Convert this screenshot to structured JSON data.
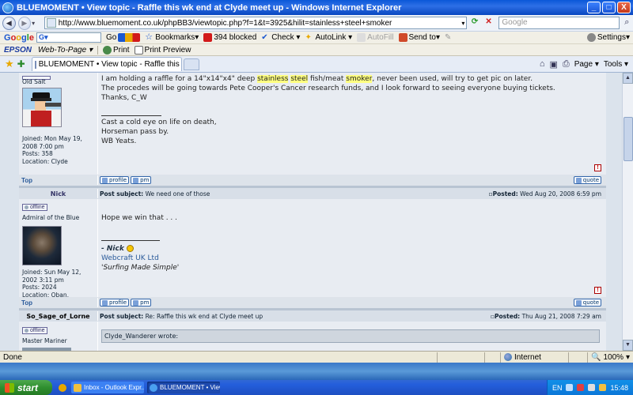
{
  "window": {
    "title": "BLUEMOMENT • View topic - Raffle this wk end at Clyde meet up - Windows Internet Explorer",
    "minimize": "_",
    "maximize": "□",
    "close": "X"
  },
  "address": {
    "url": "http://www.bluemoment.co.uk/phpBB3/viewtopic.php?f=1&t=3925&hilit=stainless+steel+smoker",
    "search_placeholder": "Google"
  },
  "google_toolbar": {
    "logo_parts": [
      "G",
      "o",
      "o",
      "g",
      "l",
      "e"
    ],
    "search_value": "G▾",
    "go": "Go",
    "bookmarks": "Bookmarks▾",
    "blocked": "394 blocked",
    "check": "Check ▾",
    "autolink": "AutoLink ▾",
    "autofill": "AutoFill",
    "send_to": "Send to▾",
    "settings": "Settings▾"
  },
  "epson_toolbar": {
    "logo": "EPSON",
    "web_to_page": "Web-To-Page ▾",
    "print": "Print",
    "print_preview": "Print Preview"
  },
  "tabs": {
    "active_tab": "BLUEMOMENT • View topic - Raffle this wk end at Clyde...",
    "page": "Page ▾",
    "tools": "Tools ▾"
  },
  "posts": [
    {
      "rank": "Old Salt",
      "joined": "Joined: Mon May 19, 2008 7:00 pm",
      "posts": "Posts: 358",
      "location": "Location: Clyde",
      "body_line1_pre": "I am holding a raffle for a 14\"x14\"x4\" deep ",
      "hl1": "stainless",
      "hl2": "steel",
      "mid1": " fish/meat ",
      "hl3": "smoker",
      "body_line1_post": ", never been used, will try to get pic on later.",
      "body_line2": "The procedes will be going towards Pete Cooper's Cancer research funds, and I look forward to seeing everyone buying tickets.",
      "body_line3": "Thanks, C_W",
      "sig_line1": "Cast a cold eye on life on death,",
      "sig_line2": "Horseman pass by.",
      "sig_line3": "WB Yeats."
    },
    {
      "author": "Nick",
      "subject_label": "Post subject:",
      "subject": "We need one of those",
      "posted_label": "Posted:",
      "posted": "Wed Aug 20, 2008 6:59 pm",
      "status": "offline",
      "rank": "Admiral of the Blue",
      "joined": "Joined: Sun May 12, 2002 3:11 pm",
      "posts": "Posts: 2024",
      "location": "Location: Oban, Scotland",
      "body": "Hope we win that . . .",
      "sig_name": "- Nick",
      "sig_company": "Webcraft UK Ltd",
      "sig_tagline": "'Surfing Made Simple'"
    },
    {
      "author": "So_Sage_of_Lorne",
      "subject_label": "Post subject:",
      "subject": "Re: Raffle this wk end at Clyde meet up",
      "posted_label": "Posted:",
      "posted": "Thu Aug 21, 2008 7:29 am",
      "status": "offline",
      "rank": "Master Mariner",
      "quote_head": "Clyde_Wanderer wrote:"
    }
  ],
  "buttons": {
    "top": "Top",
    "profile": "profile",
    "pm": "pm",
    "quote": "quote",
    "report": "!"
  },
  "statusbar": {
    "done": "Done",
    "zone": "Internet",
    "zoom": "100%"
  },
  "taskbar": {
    "start": "start",
    "items": [
      "Inbox - Outlook Expr...",
      "BLUEMOMENT • View ..."
    ],
    "lang": "EN",
    "time": "15:48"
  }
}
